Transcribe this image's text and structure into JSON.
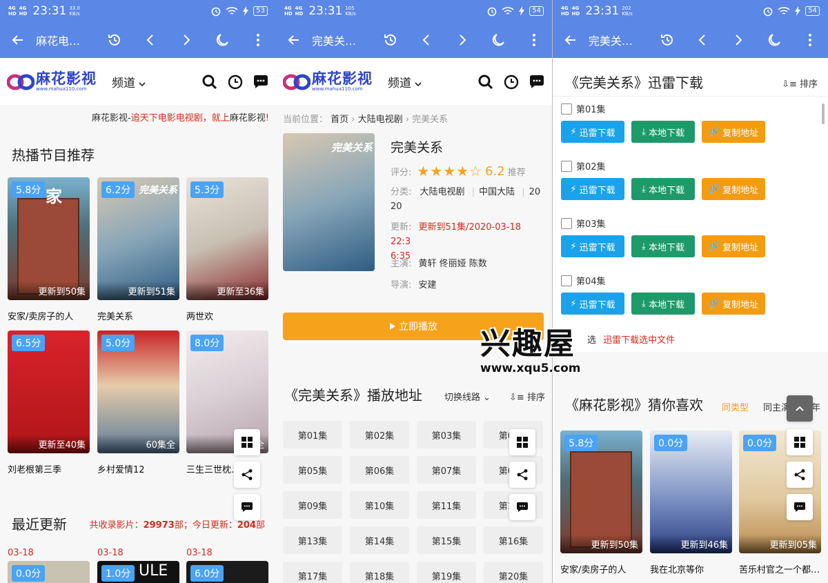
{
  "status": {
    "net": "4G HD",
    "time": "23:31",
    "screens": [
      {
        "speed": "33.0\nKB/s",
        "battery": "53"
      },
      {
        "speed": "105\nKB/s",
        "battery": "54"
      },
      {
        "speed": "202\nKB/s",
        "battery": "54"
      }
    ]
  },
  "browser": {
    "titles": [
      "麻花电…",
      "完美关…",
      "完美关…"
    ]
  },
  "site": {
    "logo_name": "麻花影视",
    "logo_url": "www.mahua110.com",
    "channel": "频道"
  },
  "home": {
    "slogan_prefix": "麻花影视-",
    "slogan_red1": "追天下电影电视剧，就上",
    "slogan_mid": "麻花影视",
    "slogan_end": "!",
    "hot_title": "热播节目推荐",
    "cards": [
      {
        "score": "5.8分",
        "ep": "更新到50集",
        "title": "安家/卖房子的人"
      },
      {
        "score": "6.2分",
        "ep": "更新到51集",
        "title": "完美关系"
      },
      {
        "score": "5.3分",
        "ep": "更新至36集",
        "title": "两世欢"
      },
      {
        "score": "6.5分",
        "ep": "更新至40集",
        "title": "刘老根第三季"
      },
      {
        "score": "5.0分",
        "ep": "60集全",
        "title": "乡村爱情12"
      },
      {
        "score": "8.0分",
        "ep": "56集全",
        "title": "三生三世枕…"
      }
    ],
    "recent_title": "最近更新",
    "recent_stats_label1": "共收录影片：",
    "recent_stats_val1": "29973",
    "recent_stats_label2": "部；今日更新：",
    "recent_stats_val2": "204",
    "recent_stats_unit": "部",
    "recent_dates": [
      "03-18",
      "03-18",
      "03-18"
    ],
    "recent_scores": [
      "0.0分",
      "1.0分",
      "6.0分"
    ],
    "recent_poster_text": "ULE"
  },
  "detail": {
    "breadcrumb_label": "当前位置：",
    "crumb_home": "首页",
    "crumb_cat": "大陆电视剧",
    "crumb_cur": "完美关系",
    "title": "完美关系",
    "poster_text": "完美关系",
    "rating_label": "评分:",
    "rating_value": "6.2",
    "rating_suffix": "推荐",
    "rating_stars": 4,
    "cat_label": "分类:",
    "cat_1": "大陆电视剧",
    "cat_2": "中国大陆",
    "cat_3a": "20",
    "cat_3b": "20",
    "update_label": "更新:",
    "update_a": "更新到51集/2020-03-18 22:3",
    "update_b": "6:35",
    "actor_label": "主演:",
    "actors": "黄轩 佟丽娅 陈数",
    "director_label": "导演:",
    "director": "安建",
    "play_button": "立即播放",
    "play_title": "《完美关系》播放地址",
    "switch_line": "切换线路",
    "sort": "排序",
    "episodes": [
      "第01集",
      "第02集",
      "第03集",
      "第04集",
      "第05集",
      "第06集",
      "第07集",
      "第08集",
      "第09集",
      "第10集",
      "第11集",
      "第12集",
      "第13集",
      "第14集",
      "第15集",
      "第16集",
      "第17集",
      "第18集",
      "第19集",
      "第20集"
    ]
  },
  "download": {
    "title": "《完美关系》迅雷下载",
    "sort": "排序",
    "rows": [
      "第01集",
      "第02集",
      "第03集",
      "第04集"
    ],
    "btn_xunlei": "迅雷下载",
    "btn_local": "本地下载",
    "btn_copy": "复制地址",
    "select_fragment": "选",
    "select_link": "迅雷下载选中文件",
    "guess_title": "《麻花影视》猜你喜欢",
    "guess_tab1": "同类型",
    "guess_tab2": "同主演",
    "guess_tab3": "同年",
    "guess_cards": [
      {
        "score": "5.8分",
        "ep": "更新到50集",
        "title": "安家/卖房子的人"
      },
      {
        "score": "0.0分",
        "ep": "更新到46集",
        "title": "我在北京等你"
      },
      {
        "score": "0.0分",
        "ep": "更新到05集",
        "title": "苦乐村官之一个都…"
      }
    ]
  },
  "watermark": {
    "text": "兴趣屋",
    "url": "www.xqu5.com"
  },
  "colors": {
    "browser_bar": "#5b87e6",
    "brand_blue": "#2e45c8",
    "score_badge": "#4aa3f5",
    "play_orange": "#f7a21b",
    "link_red": "#d9281c",
    "xunlei_blue": "#1aa2ea",
    "local_green": "#1e9a6a",
    "copy_orange": "#f39c12"
  }
}
